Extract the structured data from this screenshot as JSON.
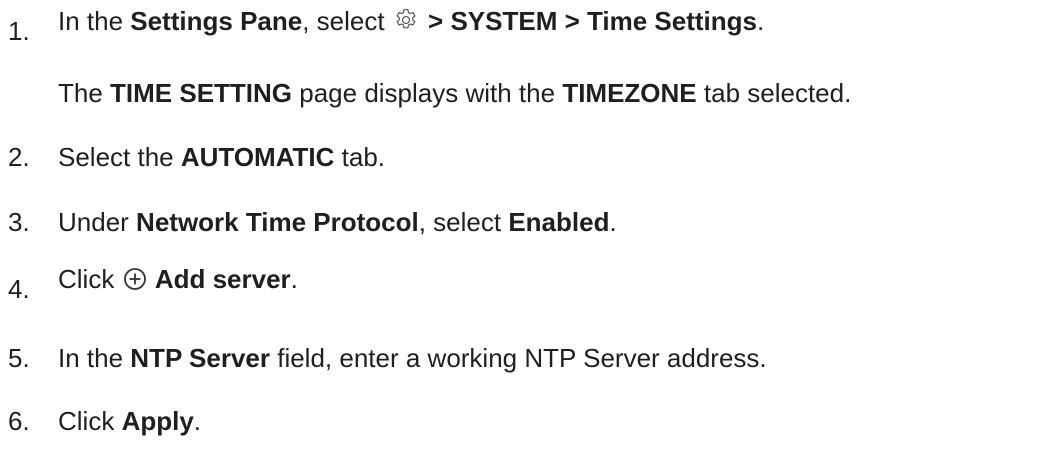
{
  "steps": [
    {
      "number": "1.",
      "parts": {
        "a": "In the ",
        "b": "Settings Pane",
        "c": ", select ",
        "d": " > SYSTEM > Time Settings",
        "e": "."
      },
      "icon": "gear-icon"
    },
    {
      "number": "",
      "parts": {
        "a": "The ",
        "b": "TIME SETTING",
        "c": " page displays with the ",
        "d": "TIMEZONE",
        "e": " tab selected."
      }
    },
    {
      "number": "2.",
      "parts": {
        "a": "Select the ",
        "b": "AUTOMATIC",
        "c": " tab."
      }
    },
    {
      "number": "3.",
      "parts": {
        "a": "Under ",
        "b": "Network Time Protocol",
        "c": ", select ",
        "d": "Enabled",
        "e": "."
      }
    },
    {
      "number": "4.",
      "parts": {
        "a": "Click ",
        "b": " Add server",
        "c": "."
      },
      "icon": "plus-circle-icon"
    },
    {
      "number": "5.",
      "parts": {
        "a": "In the ",
        "b": "NTP Server",
        "c": " field, enter a working NTP Server address."
      }
    },
    {
      "number": "6.",
      "parts": {
        "a": "Click ",
        "b": "Apply",
        "c": "."
      }
    }
  ],
  "colors": {
    "text": "#1f1f1f",
    "icon": "#555555",
    "background": "#ffffff"
  }
}
